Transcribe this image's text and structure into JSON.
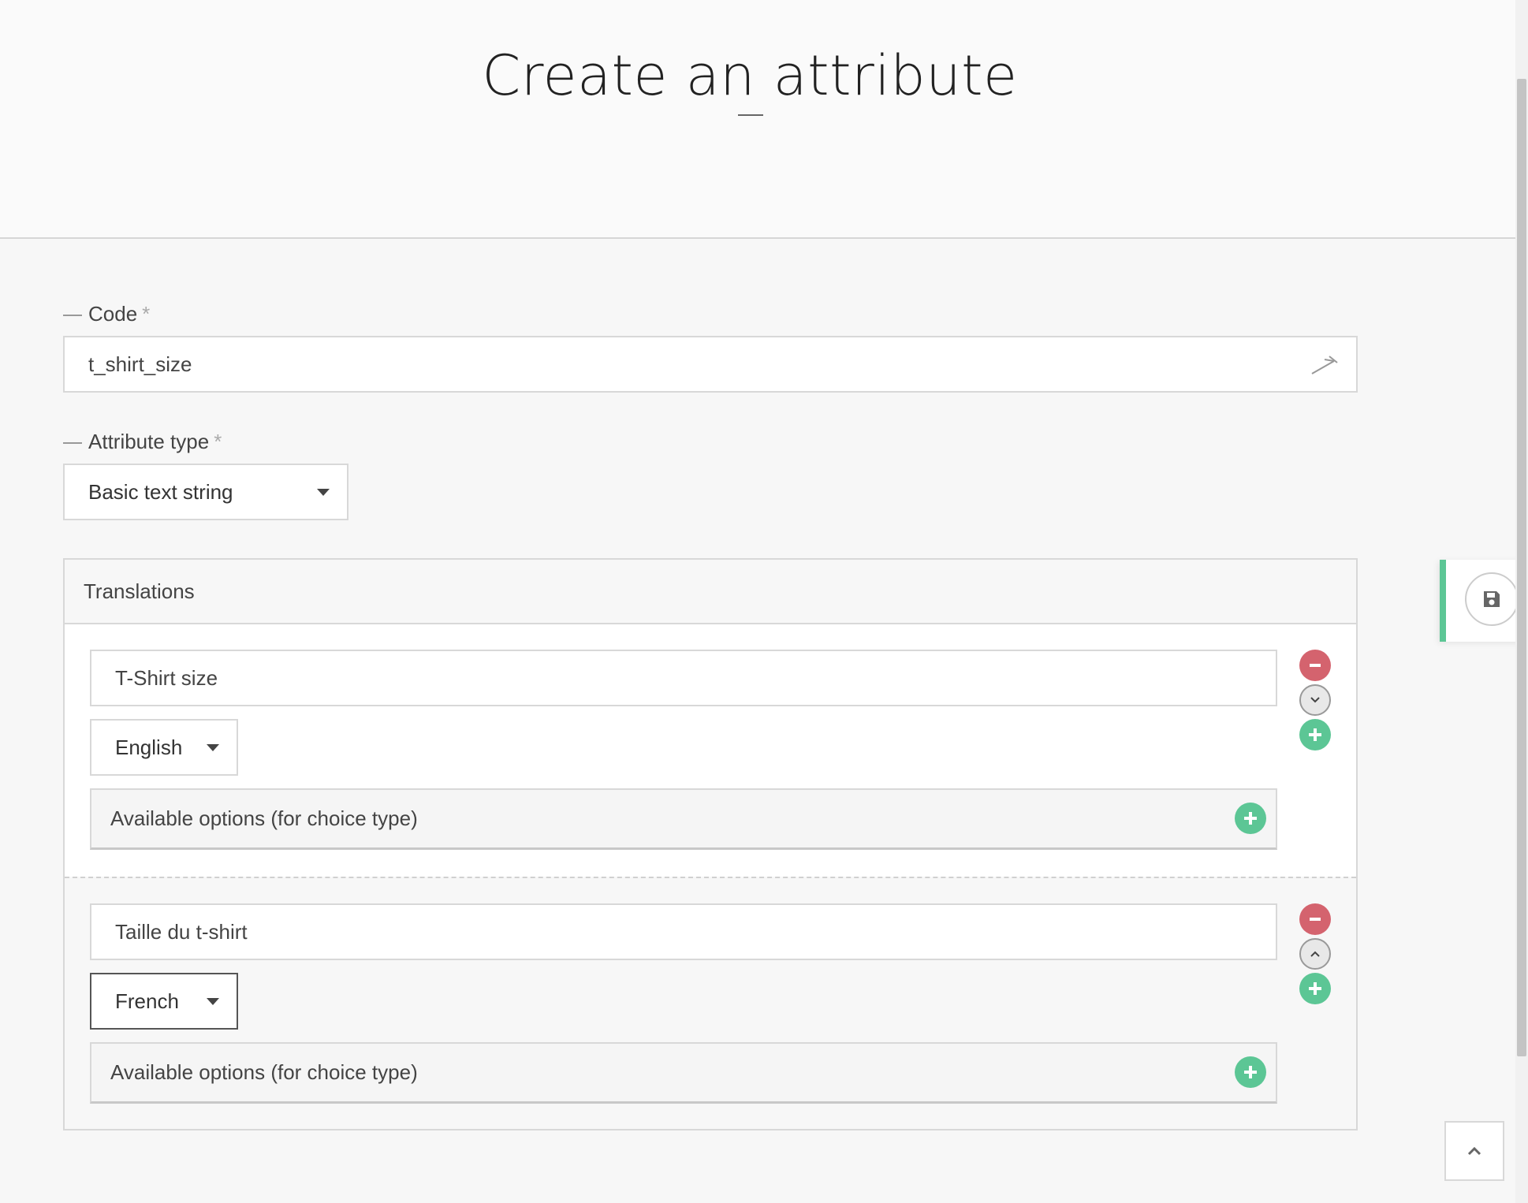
{
  "header": {
    "title": "Create an attribute"
  },
  "code_field": {
    "label": "Code",
    "required_mark": "*",
    "value": "t_shirt_size"
  },
  "type_field": {
    "label": "Attribute type",
    "required_mark": "*",
    "selected": "Basic text string"
  },
  "translations": {
    "title": "Translations",
    "items": [
      {
        "value": "T-Shirt size",
        "language": "English",
        "options_label": "Available options (for choice type)"
      },
      {
        "value": "Taille du t-shirt",
        "language": "French",
        "options_label": "Available options (for choice type)"
      }
    ]
  },
  "colors": {
    "accent": "#5cc695",
    "danger": "#d4636e"
  },
  "icons": {
    "code_generate": "wand-icon",
    "save": "floppy-disk-icon",
    "scroll_top": "chevron-up-icon",
    "remove": "minus-icon",
    "add": "plus-icon",
    "move_down": "chevron-down-icon",
    "move_up": "chevron-up-icon"
  }
}
